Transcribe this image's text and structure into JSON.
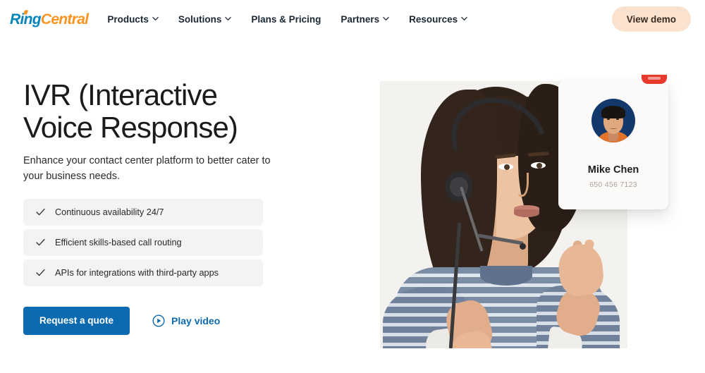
{
  "header": {
    "logo": {
      "part1": "Ring",
      "part2": "Central"
    },
    "nav_items": [
      {
        "label": "Products",
        "has_chevron": true
      },
      {
        "label": "Solutions",
        "has_chevron": true
      },
      {
        "label": "Plans & Pricing",
        "has_chevron": false
      },
      {
        "label": "Partners",
        "has_chevron": true
      },
      {
        "label": "Resources",
        "has_chevron": true
      }
    ],
    "demo_button": "View demo"
  },
  "hero": {
    "headline": "IVR (Interactive Voice Response)",
    "subheadline": "Enhance your contact center platform to better cater to your business needs.",
    "features": [
      "Continuous availability 24/7",
      "Efficient skills-based call routing",
      "APIs for integrations with third-party apps"
    ],
    "primary_cta": "Request a quote",
    "secondary_cta": "Play video"
  },
  "contact_card": {
    "name": "Mike Chen",
    "phone": "650 456 7123"
  },
  "colors": {
    "logo_blue": "#0684bc",
    "logo_orange": "#f89520",
    "primary_blue": "#0b6ab0",
    "demo_button_bg": "#fae2cf",
    "feature_row_bg": "#f4f3f1",
    "end_call_red": "#e8392d",
    "media_bg": "#f4f2ef"
  }
}
